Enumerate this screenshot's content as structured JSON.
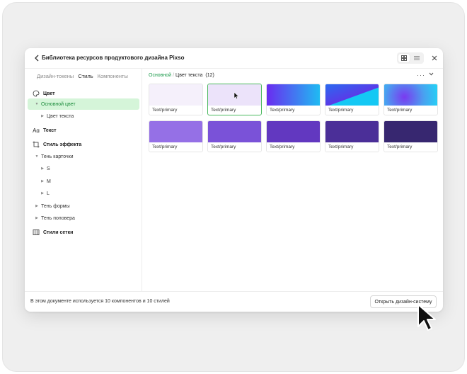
{
  "window": {
    "title": "Библиотека ресурсов продуктового дизайна Pixso",
    "back_icon": "chevron-left-icon",
    "grid_view_icon": "grid-icon",
    "list_view_icon": "list-icon",
    "close_icon": "close-icon"
  },
  "sidebar": {
    "tabs": [
      {
        "label": "Дизайн-токены",
        "active": false
      },
      {
        "label": "Стиль",
        "active": true
      },
      {
        "label": "Компоненты",
        "active": false
      }
    ],
    "items": [
      {
        "label": "Цвет",
        "type": "section",
        "icon": "color-palette-icon"
      },
      {
        "label": "Основной цвет",
        "type": "item",
        "selected": true,
        "expanded": true
      },
      {
        "label": "Цвет текста",
        "type": "subitem"
      },
      {
        "label": "Текст",
        "type": "section",
        "icon": "text-icon"
      },
      {
        "label": "Стиль эффекта",
        "type": "section",
        "icon": "effect-icon"
      },
      {
        "label": "Тень карточки",
        "type": "item",
        "expanded": true
      },
      {
        "label": "S",
        "type": "subitem"
      },
      {
        "label": "M",
        "type": "subitem"
      },
      {
        "label": "L",
        "type": "subitem"
      },
      {
        "label": "Тень формы",
        "type": "item"
      },
      {
        "label": "Тень поповера",
        "type": "item"
      },
      {
        "label": "Стили сетки",
        "type": "section",
        "icon": "grid-layout-icon"
      }
    ]
  },
  "content": {
    "breadcrumb": {
      "parent": "Основной",
      "separator": "/",
      "current": "Цвет текста",
      "count": "(12)"
    },
    "more_icon": "more-icon",
    "collapse_icon": "chevron-down-icon",
    "cards": [
      {
        "label": "Text/primary",
        "fill": "#f5f0fb",
        "selected": false
      },
      {
        "label": "Text/primary",
        "fill": "#ece3fa",
        "selected": true
      },
      {
        "label": "Text/primary",
        "fill": "linear-gradient(90deg, #6a2cf0 0%, #1fbbf2 100%)",
        "selected": false
      },
      {
        "label": "Text/primary",
        "fill": "linear-gradient(160deg, #2a6af0 0%, #5a3ae8 55%, #14c8f4 56%)",
        "selected": false
      },
      {
        "label": "Text/primary",
        "fill": "radial-gradient(circle at 38% 60%, #7a3af0 0%, #4aa0f0 55%, #22d4f6 100%)",
        "selected": false
      },
      {
        "label": "Text/primary",
        "fill": "#9570e6",
        "selected": false
      },
      {
        "label": "Text/primary",
        "fill": "#7a52d8",
        "selected": false
      },
      {
        "label": "Text/primary",
        "fill": "#6238c0",
        "selected": false
      },
      {
        "label": "Text/primary",
        "fill": "#4b2f98",
        "selected": false
      },
      {
        "label": "Text/primary",
        "fill": "#372770",
        "selected": false
      }
    ]
  },
  "footer": {
    "info": "В этом документе используется 10 компонентов и 10 стилей",
    "open_button": "Открыть дизайн-систему"
  },
  "colors": {
    "accent_green": "#1a9a4a",
    "selected_bg": "#d5f5d9"
  }
}
